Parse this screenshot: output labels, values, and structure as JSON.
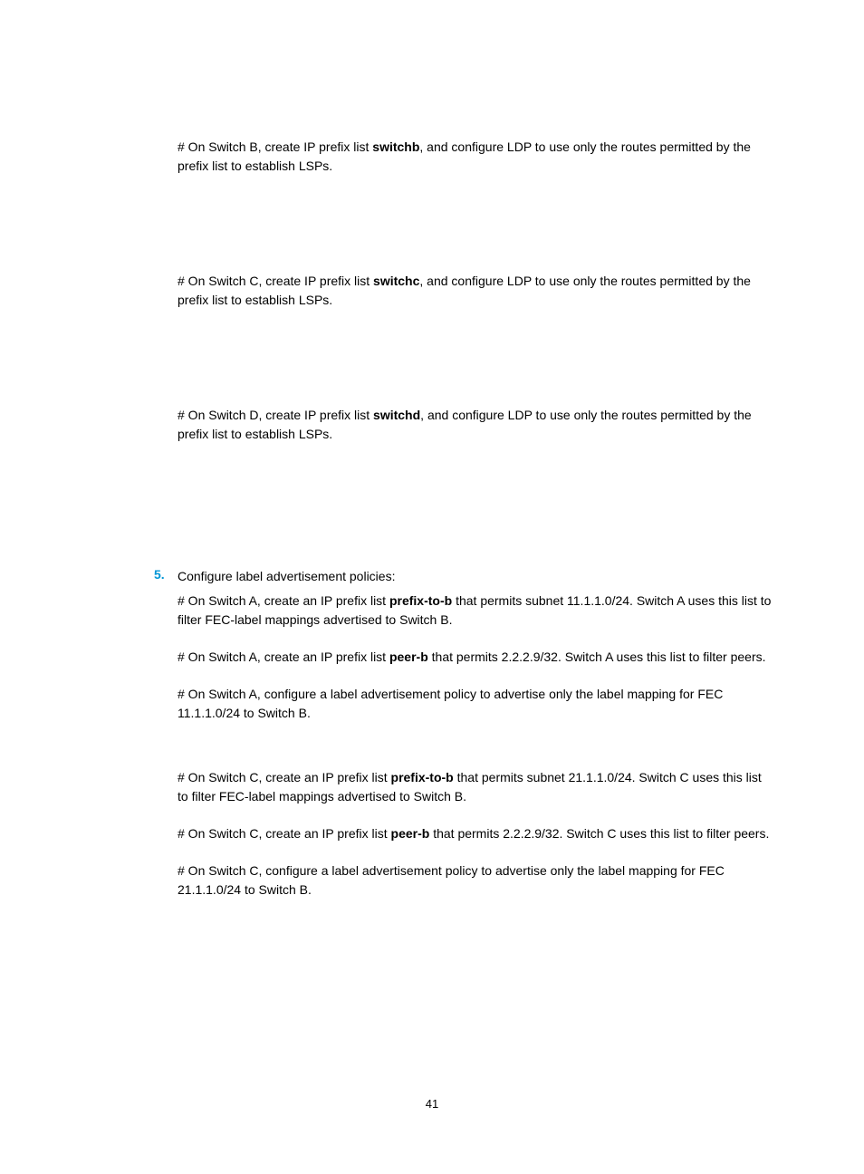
{
  "sections": {
    "switchB": {
      "intro_pre": "# On Switch B, create IP prefix list ",
      "intro_bold": "switchb",
      "intro_post": ", and configure LDP to use only the routes permitted by the prefix list to establish LSPs."
    },
    "switchC": {
      "intro_pre": "# On Switch C, create IP prefix list ",
      "intro_bold": "switchc",
      "intro_post": ", and configure LDP to use only the routes permitted by the prefix list to establish LSPs."
    },
    "switchD": {
      "intro_pre": "# On Switch D, create IP prefix list ",
      "intro_bold": "switchd",
      "intro_post": ", and configure LDP to use only the routes permitted by the prefix list to establish LSPs."
    },
    "step5": {
      "number": "5.",
      "title": "Configure label advertisement policies:",
      "a_prefixtob": {
        "pre": "# On Switch A, create an IP prefix list ",
        "bold": "prefix-to-b",
        "post": " that permits subnet 11.1.1.0/24. Switch A uses this list to filter FEC-label mappings advertised to Switch B."
      },
      "a_peerb": {
        "pre": "# On Switch A, create an IP prefix list ",
        "bold": "peer-b",
        "post": " that permits 2.2.2.9/32. Switch A uses this list to filter peers."
      },
      "a_policy": "# On Switch A, configure a label advertisement policy to advertise only the label mapping for FEC 11.1.1.0/24 to Switch B.",
      "c_prefixtob": {
        "pre": "# On Switch C, create an IP prefix list ",
        "bold": "prefix-to-b",
        "post": " that permits subnet 21.1.1.0/24. Switch C uses this list to filter FEC-label mappings advertised to Switch B."
      },
      "c_peerb": {
        "pre": "# On Switch C, create an IP prefix list ",
        "bold": "peer-b",
        "post": " that permits 2.2.2.9/32. Switch C uses this list to filter peers."
      },
      "c_policy": "# On Switch C, configure a label advertisement policy to advertise only the label mapping for FEC 21.1.1.0/24 to Switch B."
    }
  },
  "pageNumber": "41"
}
